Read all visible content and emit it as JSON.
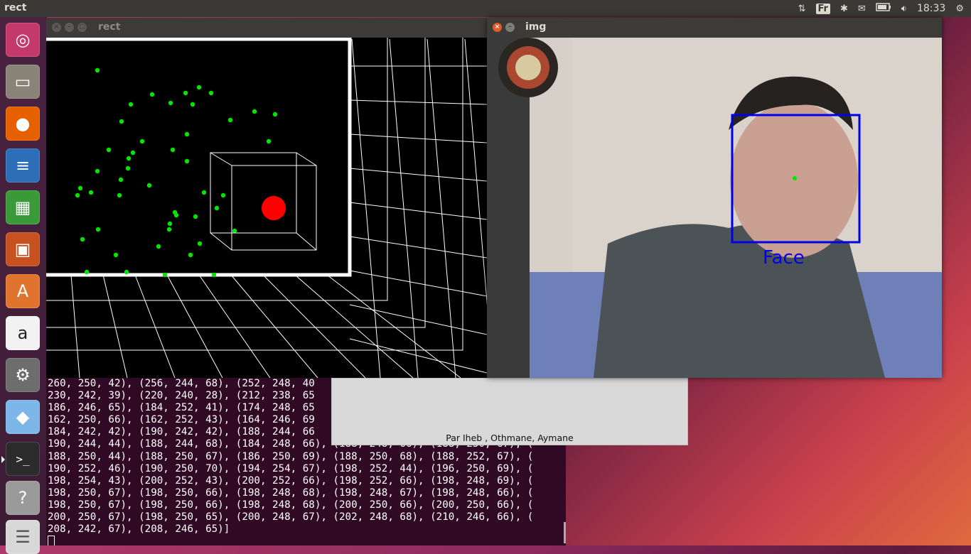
{
  "topbar": {
    "app_title": "rect",
    "keyboard_layout": "Fr",
    "clock": "18:33",
    "icons": [
      "network-icon",
      "keyboard-icon",
      "bluetooth-icon",
      "mail-icon",
      "battery-icon",
      "volume-icon",
      "gear-icon"
    ]
  },
  "launcher": {
    "items": [
      "ubuntu-logo-icon",
      "files-icon",
      "firefox-icon",
      "writer-icon",
      "calc-icon",
      "impress-icon",
      "software-center-icon",
      "amazon-icon",
      "system-settings-icon",
      "cube-app-icon",
      "terminal-icon",
      "help-icon",
      "workspace-icon"
    ]
  },
  "windows": {
    "rect": {
      "title": "rect"
    },
    "img": {
      "title": "img",
      "face_label": "Face"
    }
  },
  "tk_window": {
    "caption": "Par Iheb , Othmane, Aymane"
  },
  "terminal": {
    "lines": [
      "260, 250, 42), (256, 244, 68), (252, 248, 40",
      "230, 242, 39), (220, 240, 28), (212, 238, 65",
      "186, 246, 65), (184, 252, 41), (174, 248, 65",
      "162, 250, 66), (162, 252, 43), (164, 246, 69",
      "184, 242, 42), (190, 242, 42), (188, 244, 66",
      "190, 244, 44), (188, 244, 68), (184, 248, 66), (188, 248, 66), (188, 250, 67), (",
      "188, 250, 44), (188, 250, 67), (186, 250, 69), (188, 250, 68), (188, 252, 67), (",
      "190, 252, 46), (190, 250, 70), (194, 254, 67), (198, 252, 44), (196, 250, 69), (",
      "198, 254, 43), (200, 252, 43), (200, 252, 66), (198, 252, 66), (198, 248, 69), (",
      "198, 250, 67), (198, 250, 66), (198, 248, 68), (198, 248, 67), (198, 248, 66), (",
      "198, 250, 67), (198, 250, 66), (198, 248, 68), (200, 250, 66), (200, 250, 66), (",
      "200, 250, 67), (198, 250, 65), (200, 248, 67), (202, 248, 68), (210, 246, 66), (",
      "208, 242, 67), (208, 246, 65)]"
    ]
  },
  "colors": {
    "dot_green": "#00e600",
    "target_red": "#ff0000",
    "face_box_blue": "#0000e6",
    "terminal_bg": "#300a24"
  }
}
